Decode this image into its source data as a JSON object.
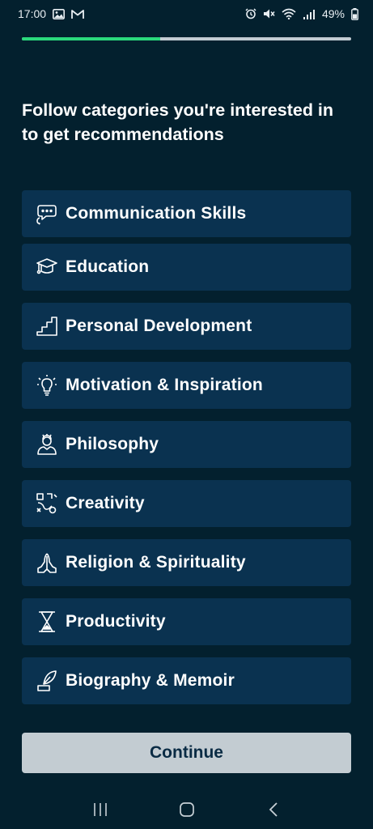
{
  "status_bar": {
    "time": "17:00",
    "battery": "49%"
  },
  "progress": {
    "fraction": 0.42
  },
  "heading": "Follow categories you're interested in to get recommendations",
  "categories": [
    {
      "label": "Communication Skills",
      "icon": "speech-bubbles-icon"
    },
    {
      "label": "Education",
      "icon": "graduation-cap-icon"
    },
    {
      "label": "Personal Development",
      "icon": "stairs-icon"
    },
    {
      "label": "Motivation & Inspiration",
      "icon": "lightbulb-icon"
    },
    {
      "label": "Philosophy",
      "icon": "thinker-icon"
    },
    {
      "label": "Creativity",
      "icon": "creativity-icon"
    },
    {
      "label": "Religion & Spirituality",
      "icon": "praying-hands-icon"
    },
    {
      "label": "Productivity",
      "icon": "hourglass-icon"
    },
    {
      "label": "Biography & Memoir",
      "icon": "quill-icon"
    }
  ],
  "continue_label": "Continue",
  "colors": {
    "background": "#03202e",
    "card": "#0a3250",
    "progress_accent": "#2bd97c",
    "button": "#c3ccd2"
  }
}
